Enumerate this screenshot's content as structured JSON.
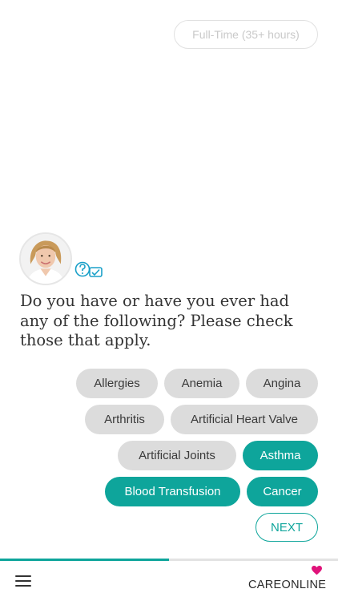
{
  "previous_answer": {
    "label": "Full-Time (35+ hours)"
  },
  "question": {
    "text": "Do you have or have you ever had any of the following? Please check those that apply."
  },
  "options": [
    {
      "label": "Allergies",
      "selected": false
    },
    {
      "label": "Anemia",
      "selected": false
    },
    {
      "label": "Angina",
      "selected": false
    },
    {
      "label": "Arthritis",
      "selected": false
    },
    {
      "label": "Artificial Heart Valve",
      "selected": false
    },
    {
      "label": "Artificial Joints",
      "selected": false
    },
    {
      "label": "Asthma",
      "selected": true
    },
    {
      "label": "Blood Transfusion",
      "selected": true
    },
    {
      "label": "Cancer",
      "selected": true
    }
  ],
  "next_button": {
    "label": "NEXT"
  },
  "progress": {
    "fraction": 0.5
  },
  "brand": {
    "name": "CAREONLINE"
  },
  "colors": {
    "accent": "#0ea59b",
    "chip": "#dcdcdc",
    "heart": "#e0137a"
  },
  "icons": {
    "menu": "hamburger-menu-icon",
    "qa": "question-chat-icon",
    "logo": "heart-icon"
  }
}
